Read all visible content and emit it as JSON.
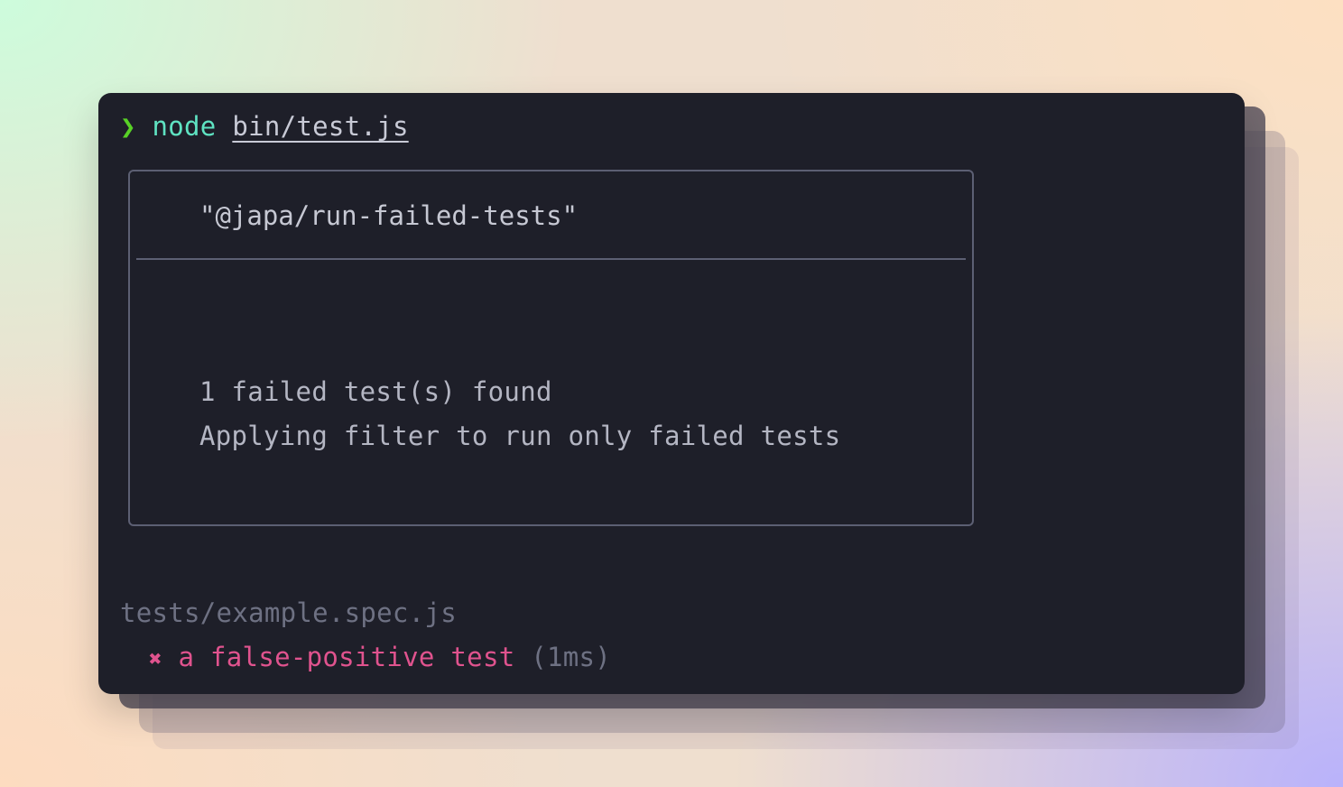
{
  "terminal": {
    "prompt": {
      "arrow": "❯",
      "command": "node",
      "argument": "bin/test.js"
    },
    "plugin_box": {
      "title": "\"@japa/run-failed-tests\"",
      "message_1": "1 failed test(s) found",
      "message_2": "Applying filter to run only failed tests"
    },
    "results": {
      "file": "tests/example.spec.js",
      "fail_icon": "✖",
      "test_name": "a false-positive test",
      "duration": "(1ms)"
    }
  },
  "colors": {
    "terminal_bg": "#1e1f29",
    "prompt_arrow": "#58d126",
    "command": "#5fe3c2",
    "failure": "#e0538e",
    "muted": "#6e7183"
  },
  "icons": {
    "prompt": "chevron-right-icon",
    "fail": "cross-icon"
  }
}
